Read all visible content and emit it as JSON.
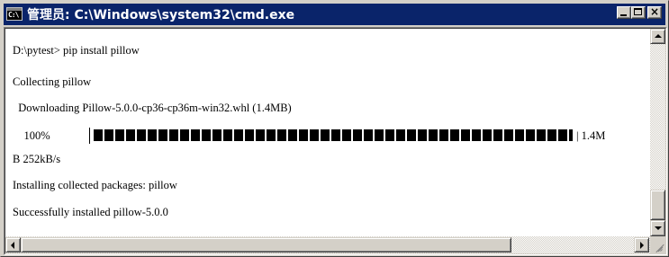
{
  "window": {
    "title": "管理员: C:\\Windows\\system32\\cmd.exe",
    "icon_text": "C:\\",
    "icon_name": "console-app-icon",
    "title_bar_color": "#0a246a",
    "buttons": {
      "minimize": "minimize-icon",
      "maximize": "maximize-icon",
      "close": "close-icon"
    }
  },
  "console": {
    "lines": [
      "D:\\pytest> pip install pillow",
      "Collecting pillow",
      "  Downloading Pillow-5.0.0-cp36-cp36m-win32.whl (1.4MB)",
      "    100%",
      "B 252kB/s",
      "Installing collected packages: pillow",
      "Successfully installed pillow-5.0.0"
    ],
    "progress_percent": 100,
    "progress_tail": "| 1.4M"
  },
  "colors": {
    "console_bg": "#ffffff",
    "console_fg": "#000000",
    "chrome": "#d4d0c8"
  }
}
